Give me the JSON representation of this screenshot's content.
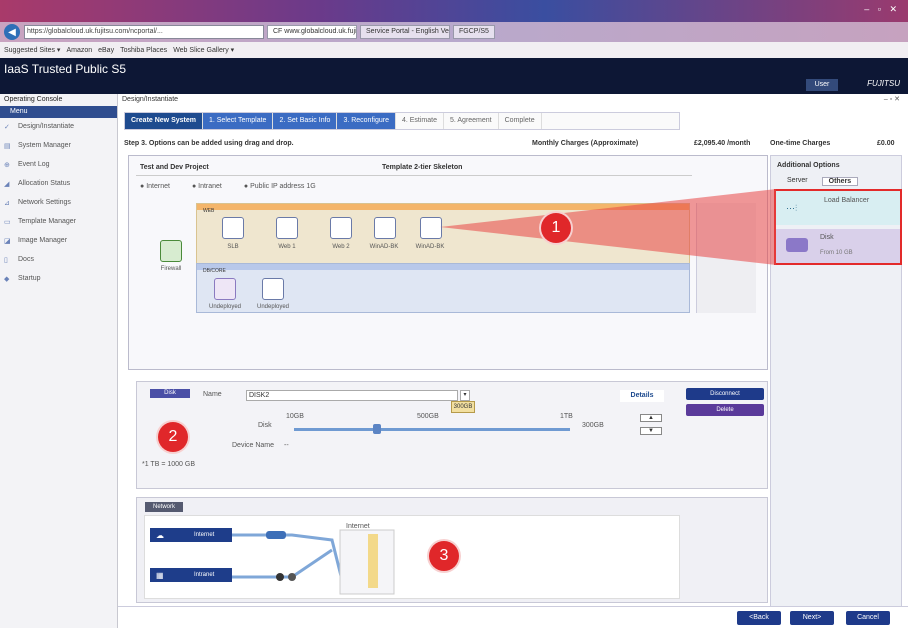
{
  "browser": {
    "window_controls": "– ▫ ✕",
    "address": "https://globalcloud.uk.fujitsu.com/ncportal/...",
    "tabs": [
      {
        "label": "CF www.globalcloud.uk.fujitsu.co..."
      },
      {
        "label": "Service Portal - English Version"
      },
      {
        "label": "FGCP/S5"
      }
    ],
    "favorites": [
      "Suggested Sites ▾",
      "Amazon",
      "eBay",
      "Toshiba Places",
      "Web Slice Gallery ▾"
    ]
  },
  "app": {
    "title": "IaaS Trusted Public S5",
    "user_button": "User",
    "logo": "FUJITSU",
    "breadcrumb": "Design/Instantiate",
    "panel_controls": "– ▫ ✕"
  },
  "sidebar": {
    "header": "Operating Console",
    "selected": "Menu",
    "items": [
      {
        "icon": "design-icon",
        "label": "Design/Instantiate"
      },
      {
        "icon": "system-icon",
        "label": "System Manager"
      },
      {
        "icon": "log-icon",
        "label": "Event Log"
      },
      {
        "icon": "allocation-icon",
        "label": "Allocation Status"
      },
      {
        "icon": "network-icon",
        "label": "Network Settings"
      },
      {
        "icon": "template-icon",
        "label": "Template Manager"
      },
      {
        "icon": "image-icon",
        "label": "Image Manager"
      },
      {
        "icon": "docs-icon",
        "label": "Docs"
      },
      {
        "icon": "startup-icon",
        "label": "Startup"
      }
    ]
  },
  "wizard": {
    "steps": [
      {
        "label": "Create New System",
        "state": "current"
      },
      {
        "label": "1. Select Template",
        "state": "done"
      },
      {
        "label": "2. Set Basic Info",
        "state": "done"
      },
      {
        "label": "3. Reconfigure",
        "state": "done"
      },
      {
        "label": "4. Estimate",
        "state": "todo"
      },
      {
        "label": "5. Agreement",
        "state": "todo"
      },
      {
        "label": "Complete",
        "state": "todo"
      }
    ]
  },
  "step_title": "Step 3. Options can be added using drag and drop.",
  "charges": {
    "monthly_label": "Monthly Charges (Approximate)",
    "monthly_value": "£2,095.40 /month",
    "onetime_label": "One-time Charges",
    "onetime_value": "£0.00"
  },
  "project": {
    "name": "Test and Dev Project",
    "template": "Template 2-tier Skeleton",
    "legend": [
      "Internet",
      "Intranet",
      "Public IP address 1G"
    ],
    "web_band_label": "WEB",
    "db_band_label": "DB/CORE",
    "firewall_label": "Firewall",
    "web_nodes": [
      "SLB",
      "Web 1",
      "Web 2",
      "WinAD-BK",
      "WinAD-BK"
    ],
    "db_nodes": [
      "Undeployed",
      "Undeployed"
    ]
  },
  "additional_options": {
    "title": "Additional Options",
    "tabs": [
      "Server",
      "Others"
    ],
    "active_tab": "Others",
    "items": [
      {
        "name": "Load Balancer",
        "icon": "load-balancer-icon"
      },
      {
        "name": "Disk",
        "detail": "From 10 GB",
        "icon": "disk-icon"
      }
    ]
  },
  "detail": {
    "badge": "Disk",
    "name_label": "Name",
    "name_value": "DISK2",
    "tooltip": "300GB",
    "details_link": "Details",
    "disconnect_btn": "Disconnect",
    "delete_btn": "Delete",
    "disk_label": "Disk",
    "min": "10GB",
    "mid": "500GB",
    "max": "1TB",
    "value": "300GB",
    "value_fraction": 0.3,
    "device_name_label": "Device Name",
    "device_name_value": "--",
    "note": "*1 TB = 1000 GB"
  },
  "network": {
    "label": "Network",
    "nodes": [
      "Internet",
      "Intranet"
    ],
    "segment_label": "Internet"
  },
  "callouts": [
    "1",
    "2",
    "3"
  ],
  "buttons": {
    "back": "<Back",
    "next": "Next>",
    "cancel": "Cancel"
  }
}
